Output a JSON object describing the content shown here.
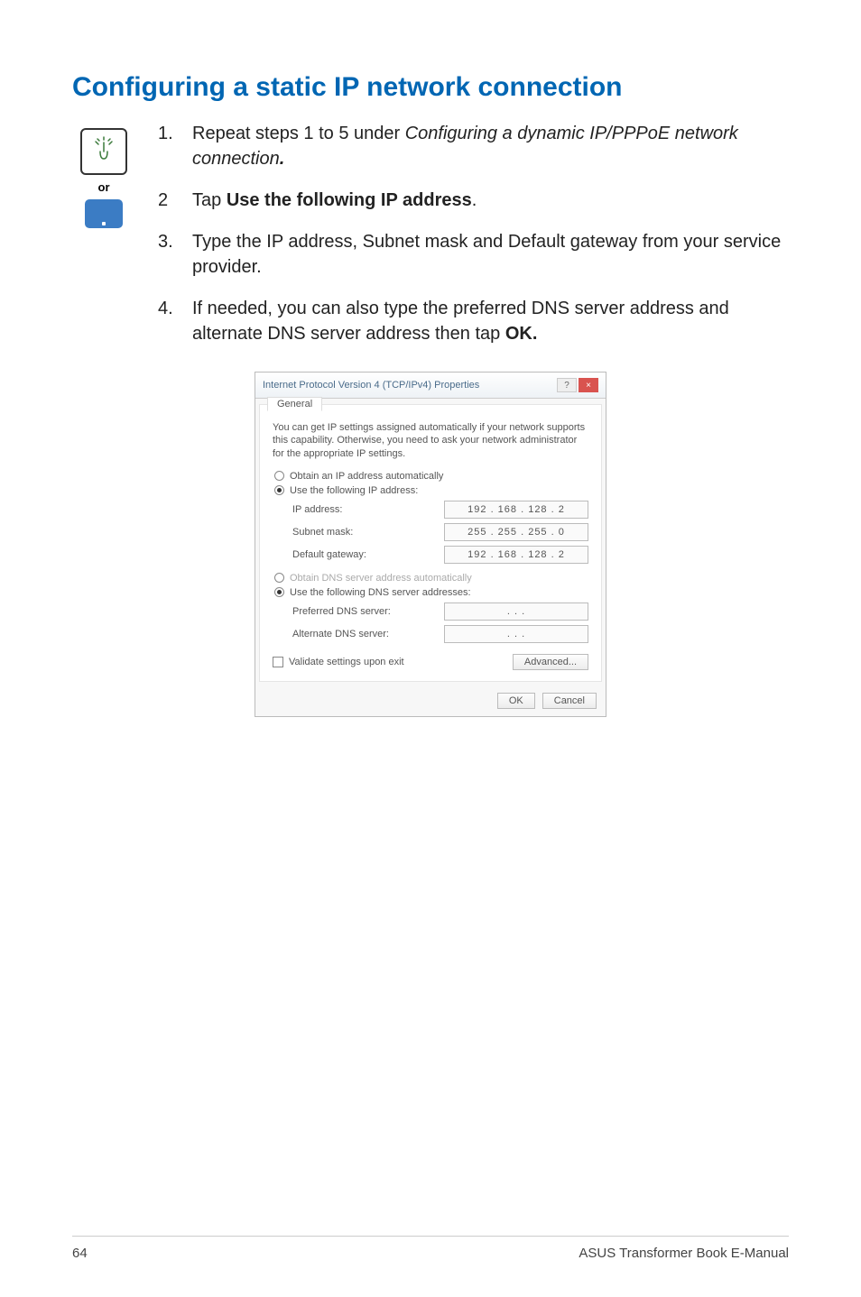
{
  "heading": "Configuring a static IP network connection",
  "icons": {
    "or_label": "or"
  },
  "steps": [
    {
      "num": "1.",
      "pre": "Repeat steps 1 to 5 under ",
      "italic": "Configuring a dynamic IP/PPPoE network connection",
      "post_bold": "."
    },
    {
      "num": "2",
      "pre": "Tap ",
      "bold": "Use the following IP address",
      "post": "."
    },
    {
      "num": "3.",
      "text": "Type the IP address, Subnet mask and Default gateway from your service provider."
    },
    {
      "num": "4.",
      "pre": "If needed, you can also type the preferred DNS server address and alternate DNS server address then tap ",
      "bold": "OK."
    }
  ],
  "dialog": {
    "title": "Internet Protocol Version 4 (TCP/IPv4) Properties",
    "help": "?",
    "close": "×",
    "tab": "General",
    "desc": "You can get IP settings assigned automatically if your network supports this capability. Otherwise, you need to ask your network administrator for the appropriate IP settings.",
    "radio_auto_ip": "Obtain an IP address automatically",
    "radio_use_ip": "Use the following IP address:",
    "ip_label": "IP address:",
    "ip_value": "192 . 168 . 128 .  2",
    "subnet_label": "Subnet mask:",
    "subnet_value": "255 . 255 . 255 .  0",
    "gateway_label": "Default gateway:",
    "gateway_value": "192 . 168 . 128 .  2",
    "radio_auto_dns": "Obtain DNS server address automatically",
    "radio_use_dns": "Use the following DNS server addresses:",
    "preferred_label": "Preferred DNS server:",
    "preferred_value": ".       .       .",
    "alternate_label": "Alternate DNS server:",
    "alternate_value": ".       .       .",
    "validate": "Validate settings upon exit",
    "advanced": "Advanced...",
    "ok": "OK",
    "cancel": "Cancel"
  },
  "footer": {
    "page": "64",
    "title": "ASUS Transformer Book E-Manual"
  }
}
